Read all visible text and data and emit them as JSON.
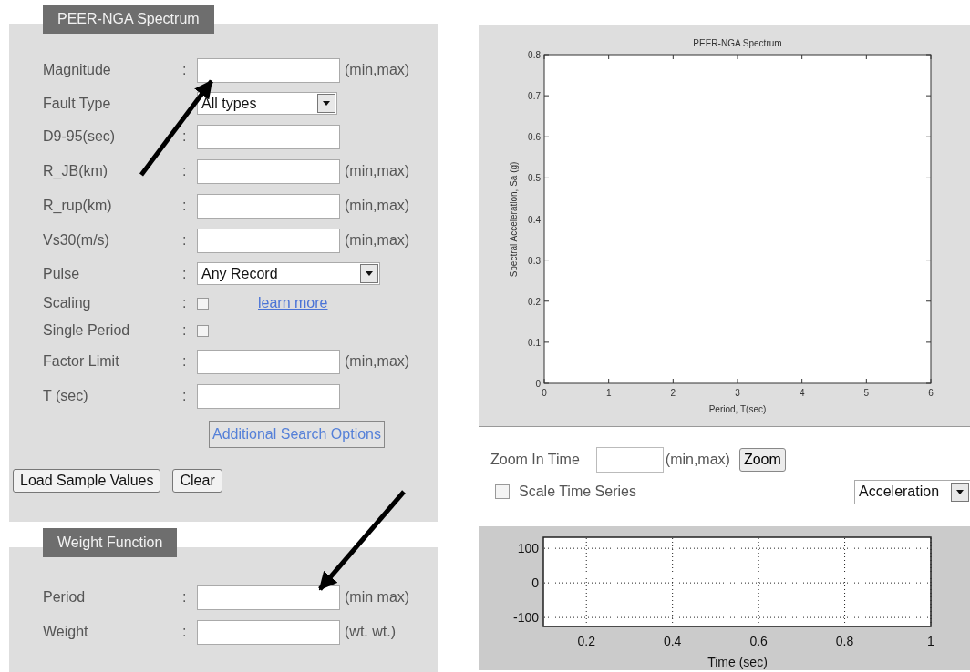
{
  "spectrum_panel": {
    "tab": "PEER-NGA Spectrum",
    "fields": [
      {
        "kind": "text",
        "label": "Magnitude",
        "colon": ":",
        "hint": "(min,max)"
      },
      {
        "kind": "select",
        "label": "Fault Type",
        "value": "All types"
      },
      {
        "kind": "text",
        "label": "D9-95(sec)",
        "colon": ":"
      },
      {
        "kind": "text",
        "label": "R_JB(km)",
        "colon": ":",
        "hint": "(min,max)"
      },
      {
        "kind": "text",
        "label": "R_rup(km)",
        "colon": ":",
        "hint": "(min,max)"
      },
      {
        "kind": "text",
        "label": "Vs30(m/s)",
        "colon": ":",
        "hint": "(min,max)"
      },
      {
        "kind": "wide-select",
        "label": "Pulse",
        "colon": ":",
        "value": "Any Record"
      },
      {
        "kind": "checkbox",
        "label": "Scaling",
        "colon": ":",
        "checked": false,
        "link": "learn more"
      },
      {
        "kind": "checkbox",
        "label": "Single Period",
        "colon": ":",
        "checked": false
      },
      {
        "kind": "text",
        "label": "Factor Limit",
        "colon": ":",
        "hint": "(min,max)"
      },
      {
        "kind": "text",
        "label": "T (sec)",
        "colon": ":"
      }
    ],
    "options_button": "Additional Search Options",
    "buttons": [
      "Load Sample Values",
      "Clear"
    ]
  },
  "weight_panel": {
    "tab": "Weight Function",
    "fields": [
      {
        "label": "Period",
        "colon": ":",
        "hint": "(min max)"
      },
      {
        "label": "Weight",
        "colon": ":",
        "hint": "(wt. wt.)"
      }
    ]
  },
  "spectrum_chart": {
    "chart_data": {
      "type": "line",
      "title": "PEER-NGA Spectrum",
      "xlabel": "Period, T(sec)",
      "ylabel": "Spectral Acceleration, Sa (g)",
      "xlim": [
        0,
        6
      ],
      "ylim": [
        0,
        0.8
      ],
      "xticks": [
        0,
        1,
        2,
        3,
        4,
        5,
        6
      ],
      "yticks": [
        0,
        0.1,
        0.2,
        0.3,
        0.4,
        0.5,
        0.6,
        0.7,
        0.8
      ]
    }
  },
  "zoom_controls": {
    "label": "Zoom In Time",
    "hint": "(min,max)",
    "button": "Zoom",
    "scale_checkbox": {
      "label": "Scale Time Series",
      "checked": false
    },
    "series_select": {
      "value": "Acceleration"
    }
  },
  "time_chart": {
    "chart_data": {
      "type": "line",
      "xlabel": "Time (sec)",
      "xlim": [
        0.1,
        1
      ],
      "ylim": [
        -126,
        132
      ],
      "xticks": [
        0.2,
        0.4,
        0.6,
        0.8,
        1
      ],
      "yticks": [
        -100,
        0,
        100
      ],
      "grid": true
    }
  }
}
